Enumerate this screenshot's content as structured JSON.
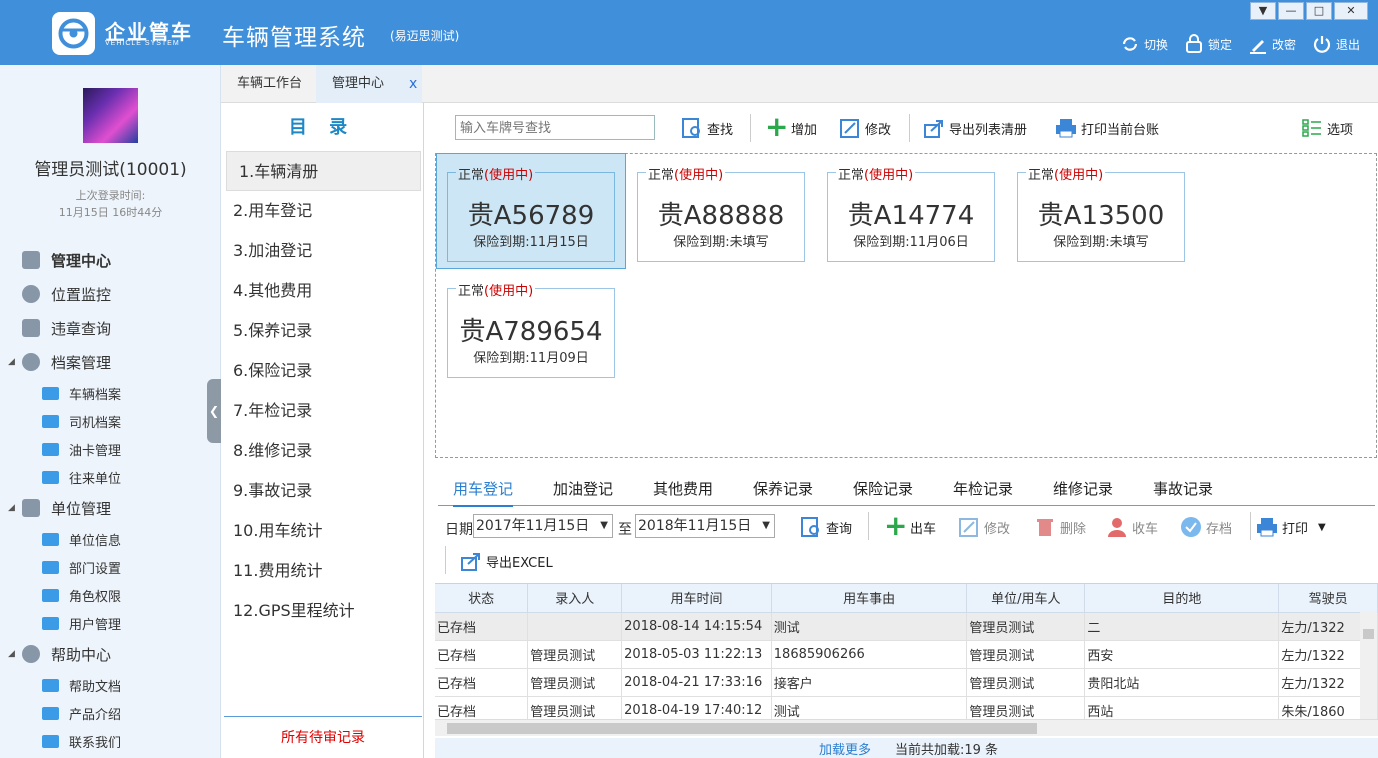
{
  "header": {
    "logo_text": "企业管车",
    "logo_sub": "VEHICLE SYSTEM",
    "title": "车辆管理系统",
    "subtitle": "(易迈思测试)",
    "actions": [
      {
        "label": "切换",
        "icon": "switch-icon"
      },
      {
        "label": "锁定",
        "icon": "lock-icon"
      },
      {
        "label": "改密",
        "icon": "pen-icon"
      },
      {
        "label": "退出",
        "icon": "power-icon"
      }
    ],
    "window_buttons": [
      "▼",
      "—",
      "□",
      "✕"
    ]
  },
  "user": {
    "name": "管理员测试(10001)",
    "last_login_label": "上次登录时间:",
    "last_login_time": "11月15日 16时44分"
  },
  "nav": {
    "management": "管理中心",
    "location": "位置监控",
    "violation": "违章查询",
    "archive": "档案管理",
    "archive_items": [
      "车辆档案",
      "司机档案",
      "油卡管理",
      "往来单位"
    ],
    "unit": "单位管理",
    "unit_items": [
      "单位信息",
      "部门设置",
      "角色权限",
      "用户管理"
    ],
    "help": "帮助中心",
    "help_items": [
      "帮助文档",
      "产品介绍",
      "联系我们"
    ]
  },
  "tabs": {
    "workbench": "车辆工作台",
    "management": "管理中心",
    "close": "x"
  },
  "directory": {
    "title": "目 录",
    "items": [
      "1.车辆清册",
      "2.用车登记",
      "3.加油登记",
      "4.其他费用",
      "5.保养记录",
      "6.保险记录",
      "7.年检记录",
      "8.维修记录",
      "9.事故记录",
      "10.用车统计",
      "11.费用统计",
      "12.GPS里程统计"
    ],
    "footer": "所有待审记录"
  },
  "toolbar": {
    "search_placeholder": "输入车牌号查找",
    "find": "查找",
    "add": "增加",
    "edit": "修改",
    "export": "导出列表清册",
    "print": "打印当前台账",
    "options": "选项"
  },
  "vehicles": [
    {
      "status": "正常",
      "inuse": "(使用中)",
      "plate": "贵A56789",
      "insurance": "保险到期:11月15日"
    },
    {
      "status": "正常",
      "inuse": "(使用中)",
      "plate": "贵A88888",
      "insurance": "保险到期:未填写"
    },
    {
      "status": "正常",
      "inuse": "(使用中)",
      "plate": "贵A14774",
      "insurance": "保险到期:11月06日"
    },
    {
      "status": "正常",
      "inuse": "(使用中)",
      "plate": "贵A13500",
      "insurance": "保险到期:未填写"
    },
    {
      "status": "正常",
      "inuse": "(使用中)",
      "plate": "贵A789654",
      "insurance": "保险到期:11月09日"
    }
  ],
  "record_tabs": [
    "用车登记",
    "加油登记",
    "其他费用",
    "保养记录",
    "保险记录",
    "年检记录",
    "维修记录",
    "事故记录"
  ],
  "query": {
    "date_label": "日期",
    "from": "2017年11月15日",
    "to_label": "至",
    "to": "2018年11月15日",
    "query": "查询",
    "out": "出车",
    "edit": "修改",
    "delete": "删除",
    "return": "收车",
    "archive": "存档",
    "print": "打印",
    "export": "导出EXCEL"
  },
  "table": {
    "headers": [
      "状态",
      "录入人",
      "用车时间",
      "用车事由",
      "单位/用车人",
      "目的地",
      "驾驶员"
    ],
    "rows": [
      [
        "已存档",
        "",
        "2018-08-14 14:15:54",
        "测试",
        "管理员测试",
        "二",
        "左力/1322"
      ],
      [
        "已存档",
        "管理员测试",
        "2018-05-03 11:22:13",
        "18685906266",
        "管理员测试",
        "西安",
        "左力/1322"
      ],
      [
        "已存档",
        "管理员测试",
        "2018-04-21 17:33:16",
        "接客户",
        "管理员测试",
        "贵阳北站",
        "左力/1322"
      ],
      [
        "已存档",
        "管理员测试",
        "2018-04-19 17:40:12",
        "测试",
        "管理员测试",
        "西站",
        "朱朱/1860"
      ]
    ]
  },
  "footer": {
    "more": "加载更多",
    "count": "当前共加载:19 条"
  }
}
